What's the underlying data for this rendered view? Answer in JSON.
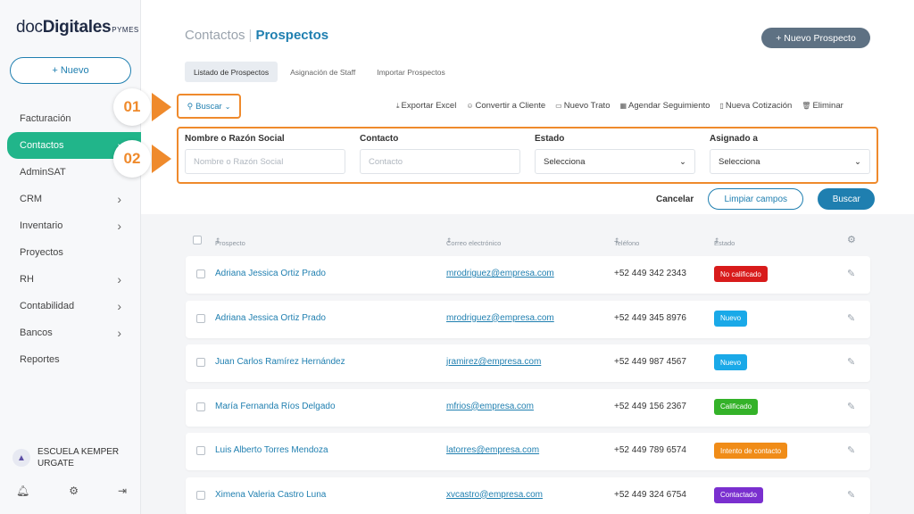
{
  "brand": {
    "name_part1": "doc",
    "name_part2": "Digitales",
    "suffix": "PYMES"
  },
  "sidebar": {
    "new_button": "+ Nuevo",
    "items": [
      {
        "label": "Facturación",
        "chevron": false,
        "active": false
      },
      {
        "label": "Contactos",
        "chevron": true,
        "active": true
      },
      {
        "label": "AdminSAT",
        "chevron": false,
        "active": false
      },
      {
        "label": "CRM",
        "chevron": true,
        "active": false
      },
      {
        "label": "Inventario",
        "chevron": true,
        "active": false
      },
      {
        "label": "Proyectos",
        "chevron": false,
        "active": false
      },
      {
        "label": "RH",
        "chevron": true,
        "active": false
      },
      {
        "label": "Contabilidad",
        "chevron": true,
        "active": false
      },
      {
        "label": "Bancos",
        "chevron": true,
        "active": false
      },
      {
        "label": "Reportes",
        "chevron": false,
        "active": false
      }
    ],
    "company": "ESCUELA KEMPER URGATE",
    "footer_icons": [
      "bell-icon",
      "gear-icon",
      "logout-icon"
    ]
  },
  "header": {
    "breadcrumb_parent": "Contactos",
    "breadcrumb_separator": "|",
    "breadcrumb_current": "Prospectos",
    "new_prospect_button": "+ Nuevo Prospecto"
  },
  "tabs": [
    {
      "label": "Listado de Prospectos",
      "active": true
    },
    {
      "label": "Asignación de Staff",
      "active": false
    },
    {
      "label": "Importar Prospectos",
      "active": false
    }
  ],
  "search_toggle": "Buscar",
  "toolbar": [
    {
      "icon": "⤓",
      "label": "Exportar Excel"
    },
    {
      "icon": "☺",
      "label": "Convertir a Cliente"
    },
    {
      "icon": "▭",
      "label": "Nuevo Trato"
    },
    {
      "icon": "▦",
      "label": "Agendar Seguimiento"
    },
    {
      "icon": "▯",
      "label": "Nueva Cotización"
    },
    {
      "icon": "🗑",
      "label": "Eliminar"
    }
  ],
  "callouts": {
    "first": "01",
    "second": "02"
  },
  "filters": {
    "name": {
      "label": "Nombre o Razón Social",
      "placeholder": "Nombre o Razón Social"
    },
    "contact": {
      "label": "Contacto",
      "placeholder": "Contacto"
    },
    "status": {
      "label": "Estado",
      "value": "Selecciona"
    },
    "assigned": {
      "label": "Asignado a",
      "value": "Selecciona"
    }
  },
  "filter_actions": {
    "cancel": "Cancelar",
    "clear": "Limpiar campos",
    "search": "Buscar"
  },
  "table": {
    "headers": {
      "prospect": "Prospecto",
      "email": "Correo electrónico",
      "phone": "Teléfono",
      "status": "Estado"
    },
    "rows": [
      {
        "name": "Adriana Jessica Ortiz Prado",
        "email": "mrodriguez@empresa.com",
        "phone": "+52 449 342 2343",
        "status": "No calificado",
        "status_color": "#d81b1b"
      },
      {
        "name": "Adriana Jessica Ortiz Prado",
        "email": "mrodriguez@empresa.com",
        "phone": "+52 449 345 8976",
        "status": "Nuevo",
        "status_color": "#1aa9e8"
      },
      {
        "name": "Juan Carlos Ramírez Hernández",
        "email": "jramirez@empresa.com",
        "phone": "+52 449 987 4567",
        "status": "Nuevo",
        "status_color": "#1aa9e8"
      },
      {
        "name": "María Fernanda Ríos Delgado",
        "email": "mfrios@empresa.com",
        "phone": "+52 449 156 2367",
        "status": "Calificado",
        "status_color": "#34b229"
      },
      {
        "name": "Luis Alberto Torres Mendoza",
        "email": "latorres@empresa.com",
        "phone": "+52 449 789 6574",
        "status": "Intento de contacto",
        "status_color": "#f08c18"
      },
      {
        "name": "Ximena Valeria Castro Luna",
        "email": "xvcastro@empresa.com",
        "phone": "+52 449 324 6754",
        "status": "Contactado",
        "status_color": "#7a2fcf"
      }
    ]
  },
  "colors": {
    "accent": "#1f7fb0",
    "active_nav": "#21b58a",
    "callout": "#ef8a2c"
  }
}
